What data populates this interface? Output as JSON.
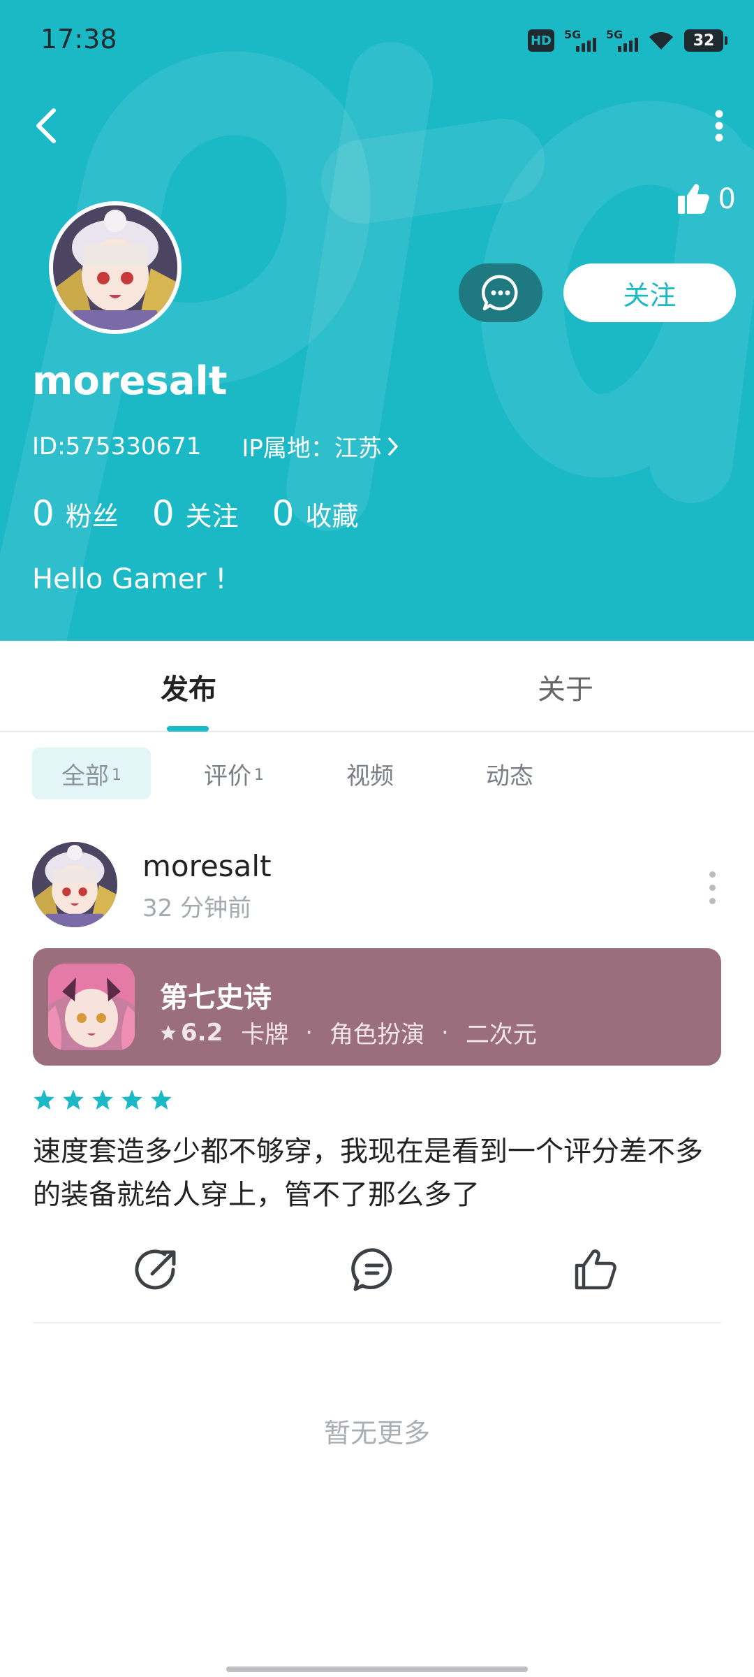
{
  "status_bar": {
    "time": "17:38",
    "hd_label": "HD",
    "network_1": "5G",
    "network_2": "5G",
    "battery": "32"
  },
  "profile": {
    "like_count": "0",
    "username": "moresalt",
    "id_label": "ID:575330671",
    "ip_label": "IP属地：江苏",
    "follow_label": "关注",
    "stats": [
      {
        "count": "0",
        "label": "粉丝"
      },
      {
        "count": "0",
        "label": "关注"
      },
      {
        "count": "0",
        "label": "收藏"
      }
    ],
    "bio": "Hello Gamer !"
  },
  "tabs": [
    {
      "label": "发布",
      "active": true
    },
    {
      "label": "关于",
      "active": false
    }
  ],
  "filters": [
    {
      "label": "全部",
      "count": "1",
      "active": true
    },
    {
      "label": "评价",
      "count": "1",
      "active": false
    },
    {
      "label": "视频",
      "count": "",
      "active": false
    },
    {
      "label": "动态",
      "count": "",
      "active": false
    }
  ],
  "post": {
    "author": "moresalt",
    "time": "32 分钟前",
    "game": {
      "title": "第七史诗",
      "score": "6.2",
      "tags": [
        "卡牌",
        "角色扮演",
        "二次元"
      ]
    },
    "rating_stars": 5,
    "text": "速度套造多少都不够穿，我现在是看到一个评分差不多的装备就给人穿上，管不了那么多了"
  },
  "footer": {
    "no_more": "暂无更多"
  },
  "colors": {
    "brand": "#1bb8c6",
    "game_card": "#9a6e7c",
    "chip_active_bg": "#e4f5f8"
  },
  "icons": [
    "back-arrow-icon",
    "more-vertical-icon",
    "thumbs-up-icon",
    "message-icon",
    "chevron-right-icon",
    "star-icon",
    "share-icon",
    "comment-icon",
    "like-icon"
  ]
}
